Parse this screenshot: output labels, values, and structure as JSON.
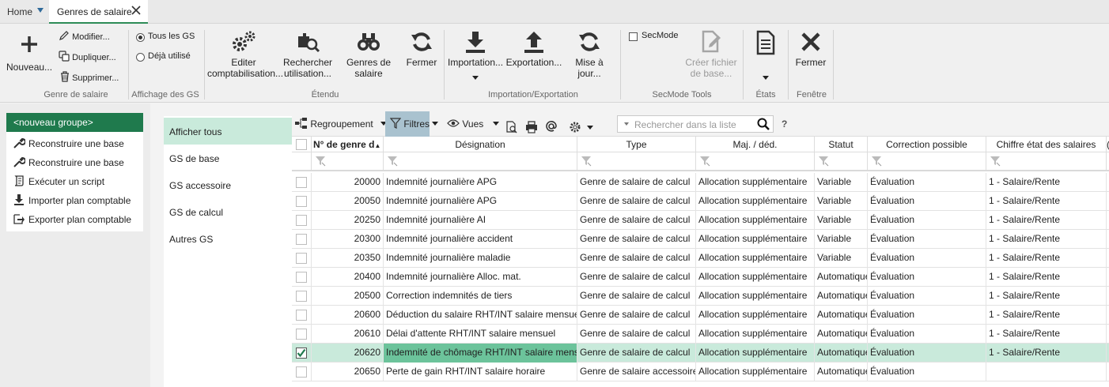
{
  "tabs": {
    "home": "Home",
    "active": "Genres de salaire"
  },
  "ribbon": {
    "nouveau": "Nouveau...",
    "modifier": "Modifier...",
    "dupliquer": "Dupliquer...",
    "supprimer": "Supprimer...",
    "group_genre": "Genre de salaire",
    "tous_gs": "Tous les GS",
    "deja_utilise": "Déjà utilisé",
    "group_affichage": "Affichage des GS",
    "editer_l1": "Editer",
    "editer_l2": "comptabilisation...",
    "rechercher_l1": "Rechercher",
    "rechercher_l2": "utilisation...",
    "genres_l1": "Genres de",
    "genres_l2": "salaire",
    "fermer1": "Fermer",
    "group_etendu": "Étendu",
    "importation": "Importation...",
    "exportation": "Exportation...",
    "mise_a_jour": "Mise à jour...",
    "group_impexp": "Importation/Exportation",
    "secmode": "SecMode",
    "creer_l1": "Créer fichier",
    "creer_l2": "de base...",
    "group_secmode": "SecMode Tools",
    "group_etats": "États",
    "fermer2": "Fermer",
    "group_fenetre": "Fenêtre"
  },
  "left": {
    "new_group": "<nouveau groupe>",
    "actions": [
      {
        "label": "Reconstruire une base",
        "icon": "wrench-icon"
      },
      {
        "label": "Reconstruire une base",
        "icon": "wrench-icon"
      },
      {
        "label": "Exécuter un script",
        "icon": "script-icon"
      },
      {
        "label": "Importer plan comptable",
        "icon": "import-icon"
      },
      {
        "label": "Exporter plan comptable",
        "icon": "export-icon"
      }
    ]
  },
  "categories": [
    "Afficher tous",
    "GS de base",
    "GS accessoire",
    "GS de calcul",
    "Autres GS"
  ],
  "toolbar": {
    "regroupement": "Regroupement",
    "filtres": "Filtres",
    "vues": "Vues",
    "search_placeholder": "Rechercher dans la liste",
    "help": "?"
  },
  "columns": [
    "N° de genre d",
    "Désignation",
    "Type",
    "Maj. / déd.",
    "Statut",
    "Correction possible",
    "Chiffre état des salaires",
    "("
  ],
  "rows": [
    {
      "num": "20000",
      "designation": "Indemnité journalière APG",
      "type": "Genre de salaire de calcul",
      "maj": "Allocation supplémentaire",
      "statut": "Variable",
      "correction": "Évaluation",
      "chiffre": "1 - Salaire/Rente",
      "checked": false
    },
    {
      "num": "20050",
      "designation": "Indemnité journalière APG",
      "type": "Genre de salaire de calcul",
      "maj": "Allocation supplémentaire",
      "statut": "Variable",
      "correction": "Évaluation",
      "chiffre": "1 - Salaire/Rente",
      "checked": false
    },
    {
      "num": "20250",
      "designation": "Indemnité journalière AI",
      "type": "Genre de salaire de calcul",
      "maj": "Allocation supplémentaire",
      "statut": "Variable",
      "correction": "Évaluation",
      "chiffre": "1 - Salaire/Rente",
      "checked": false
    },
    {
      "num": "20300",
      "designation": "Indemnité journalière accident",
      "type": "Genre de salaire de calcul",
      "maj": "Allocation supplémentaire",
      "statut": "Variable",
      "correction": "Évaluation",
      "chiffre": "1 - Salaire/Rente",
      "checked": false
    },
    {
      "num": "20350",
      "designation": "Indemnité journalière maladie",
      "type": "Genre de salaire de calcul",
      "maj": "Allocation supplémentaire",
      "statut": "Variable",
      "correction": "Évaluation",
      "chiffre": "1 - Salaire/Rente",
      "checked": false
    },
    {
      "num": "20400",
      "designation": "Indemnité journalière Alloc. mat.",
      "type": "Genre de salaire de calcul",
      "maj": "Allocation supplémentaire",
      "statut": "Automatique",
      "correction": "Évaluation",
      "chiffre": "1 - Salaire/Rente",
      "checked": false
    },
    {
      "num": "20500",
      "designation": "Correction indemnités de tiers",
      "type": "Genre de salaire de calcul",
      "maj": "Allocation supplémentaire",
      "statut": "Automatique",
      "correction": "Évaluation",
      "chiffre": "1 - Salaire/Rente",
      "checked": false
    },
    {
      "num": "20600",
      "designation": "Déduction du salaire RHT/INT salaire mensuel",
      "type": "Genre de salaire de calcul",
      "maj": "Allocation supplémentaire",
      "statut": "Automatique",
      "correction": "Évaluation",
      "chiffre": "1 - Salaire/Rente",
      "checked": false
    },
    {
      "num": "20610",
      "designation": "Délai d'attente RHT/INT salaire mensuel",
      "type": "Genre de salaire de calcul",
      "maj": "Allocation supplémentaire",
      "statut": "Automatique",
      "correction": "Évaluation",
      "chiffre": "1 - Salaire/Rente",
      "checked": false
    },
    {
      "num": "20620",
      "designation": "Indemnité de chômage RHT/INT salaire mensuel",
      "type": "Genre de salaire de calcul",
      "maj": "Allocation supplémentaire",
      "statut": "Automatique",
      "correction": "Évaluation",
      "chiffre": "1 - Salaire/Rente",
      "checked": true
    },
    {
      "num": "20650",
      "designation": "Perte de gain RHT/INT salaire horaire",
      "type": "Genre de salaire accessoire",
      "maj": "Allocation supplémentaire",
      "statut": "Automatique",
      "correction": "Évaluation",
      "chiffre": "",
      "checked": false
    }
  ],
  "colors": {
    "accent": "#1f7a4d",
    "selection": "#c9eadb",
    "highlight": "#6cc39b"
  }
}
